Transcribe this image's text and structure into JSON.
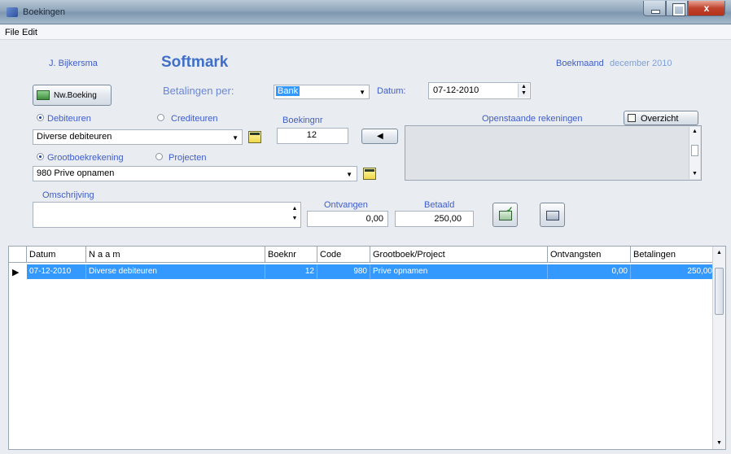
{
  "window": {
    "title": "Boekingen"
  },
  "menu": {
    "file": "File",
    "edit": "Edit"
  },
  "header": {
    "user": "J. Bijkersma",
    "app_name": "Softmark",
    "boekmaand_label": "Boekmaand",
    "boekmaand_value": "december  2010"
  },
  "form": {
    "new_booking_label": "Nw.Boeking",
    "betalingen_per_label": "Betalingen per:",
    "betalingen_per_value": "Bank",
    "datum_label": "Datum:",
    "datum_value": "07-12-2010",
    "debiteuren_label": "Debiteuren",
    "crediteuren_label": "Crediteuren",
    "boekingnr_label": "Boekingnr",
    "boekingnr_value": "12",
    "relation_value": "Diverse debiteuren",
    "openstaande_label": "Openstaande rekeningen",
    "overzicht_label": "Overzicht",
    "grootboek_label": "Grootboekrekening",
    "projecten_label": "Projecten",
    "account_value": "980 Prive opnamen",
    "omschrijving_label": "Omschrijving",
    "omschrijving_value": "",
    "ontvangen_label": "Ontvangen",
    "ontvangen_value": "0,00",
    "betaald_label": "Betaald",
    "betaald_value": "250,00"
  },
  "grid": {
    "columns": [
      "Datum",
      "N a a m",
      "Boeknr",
      "Code",
      "Grootboek/Project",
      "Ontvangsten",
      "Betalingen"
    ],
    "rows": [
      {
        "datum": "07-12-2010",
        "naam": "Diverse debiteuren",
        "boeknr": "12",
        "code": "980",
        "grootboek": "Prive opnamen",
        "ontvangsten": "0,00",
        "betalingen": "250,00"
      }
    ]
  },
  "colors": {
    "accent": "#3f5cc9",
    "selection": "#3399ff",
    "brand": "#3f6fc8"
  }
}
